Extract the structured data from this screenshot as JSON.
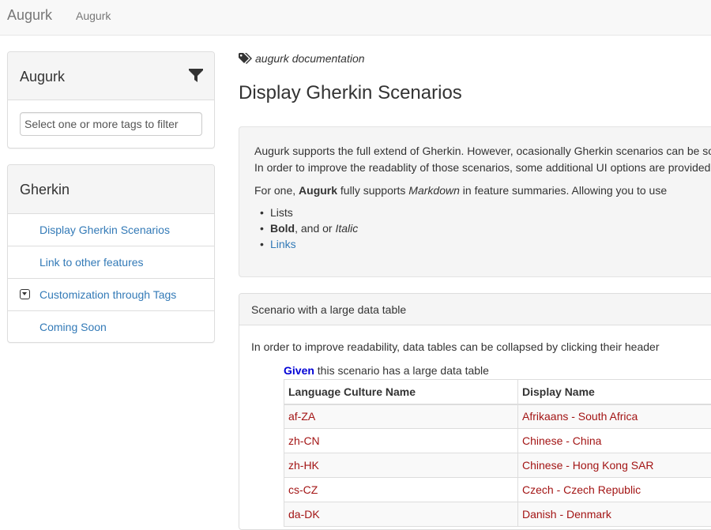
{
  "navbar": {
    "brand": "Augurk",
    "link": "Augurk"
  },
  "sidebar": {
    "filter_panel": {
      "title": "Augurk",
      "placeholder": "Select one or more tags to filter"
    },
    "group_panel": {
      "title": "Gherkin",
      "items": [
        {
          "label": "Display Gherkin Scenarios"
        },
        {
          "label": "Link to other features"
        },
        {
          "label": "Customization through Tags"
        },
        {
          "label": "Coming Soon"
        }
      ]
    }
  },
  "main": {
    "tag": "augurk documentation",
    "title": "Display Gherkin Scenarios",
    "summary": {
      "line1": "Augurk supports the full extend of Gherkin. However, ocasionally Gherkin scenarios can be so",
      "line2": "In order to improve the readablity of those scenarios, some additional UI options are provided",
      "p2_prefix": "For one, ",
      "p2_bold": "Augurk",
      "p2_mid": " fully supports ",
      "p2_italic": "Markdown",
      "p2_suffix": " in feature summaries. Allowing you to use",
      "list": {
        "item1": "Lists",
        "item2_bold": "Bold",
        "item2_mid": ", and or ",
        "item2_italic": "Italic",
        "item3": "Links"
      }
    },
    "scenario": {
      "title": "Scenario with a large data table",
      "description": "In order to improve readability, data tables can be collapsed by clicking their header",
      "step_keyword": "Given",
      "step_text": " this scenario has a large data table",
      "table": {
        "headers": [
          "Language Culture Name",
          "Display Name"
        ],
        "rows": [
          [
            "af-ZA",
            "Afrikaans - South Africa"
          ],
          [
            "zh-CN",
            "Chinese - China"
          ],
          [
            "zh-HK",
            "Chinese - Hong Kong SAR"
          ],
          [
            "cs-CZ",
            "Czech - Czech Republic"
          ],
          [
            "da-DK",
            "Danish - Denmark"
          ]
        ]
      }
    }
  }
}
